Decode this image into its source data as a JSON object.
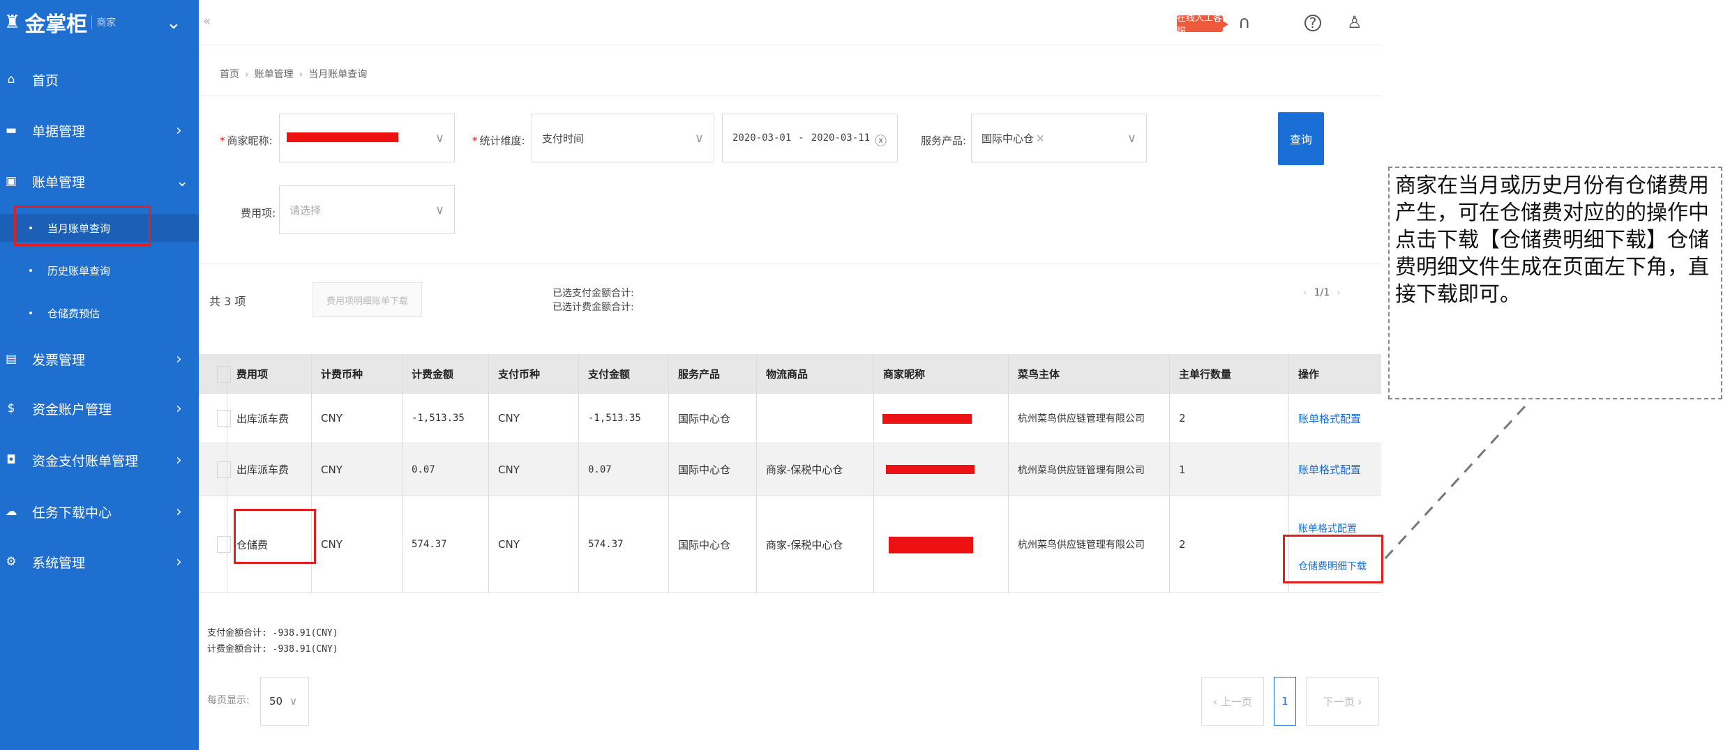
{
  "sidebar": {
    "logo_text": "金掌柜",
    "logo_sub": "商家",
    "collapse_icon": "chevron-down",
    "items": [
      {
        "label": "首页",
        "icon": "home-icon"
      },
      {
        "label": "单据管理",
        "icon": "document-icon"
      },
      {
        "label": "账单管理",
        "icon": "bill-icon"
      },
      {
        "label": "发票管理",
        "icon": "invoice-icon"
      },
      {
        "label": "资金账户管理",
        "icon": "dollar-icon"
      },
      {
        "label": "资金支付账单管理",
        "icon": "payment-icon"
      },
      {
        "label": "任务下载中心",
        "icon": "download-task-icon"
      },
      {
        "label": "系统管理",
        "icon": "settings-icon"
      }
    ],
    "sub_items": [
      {
        "label": "当月账单查询",
        "active": true
      },
      {
        "label": "历史账单查询",
        "active": false
      },
      {
        "label": "仓储费预估",
        "active": false
      }
    ],
    "accent": "#1f6fd1"
  },
  "topbar": {
    "collapse": "«",
    "online_service": "在线人工客服",
    "icons": [
      "headset-icon",
      "help-icon",
      "user-icon"
    ]
  },
  "breadcrumb": [
    "首页",
    "账单管理",
    "当月账单查询"
  ],
  "form": {
    "merchant_label": "商家昵称:",
    "dimension_label": "统计维度:",
    "dimension_value": "支付时间",
    "date_start": "2020-03-01",
    "date_sep": "-",
    "date_end": "2020-03-11",
    "product_label": "服务产品:",
    "product_tag": "国际中心仓",
    "fee_label": "费用项:",
    "fee_placeholder": "请选择",
    "query_button": "查询"
  },
  "toolbar": {
    "count": "共 3 项",
    "download_button": "费用项明细账单下载",
    "sum_paid_label": "已选支付金额合计:",
    "sum_bill_label": "已选计费金额合计:",
    "page_mini": "1/1"
  },
  "table": {
    "columns": [
      "费用项",
      "计费币种",
      "计费金额",
      "支付币种",
      "支付金额",
      "服务产品",
      "物流商品",
      "商家昵称",
      "菜鸟主体",
      "主单行数量",
      "操作"
    ],
    "rows": [
      {
        "fee": "出库派车费",
        "bill_currency": "CNY",
        "bill_amount": "-1,513.35",
        "pay_currency": "CNY",
        "pay_amount": "-1,513.35",
        "product": "国际中心仓",
        "goods": "",
        "entity": "杭州菜鸟供应链管理有限公司",
        "count": "2",
        "action1": "账单格式配置",
        "action2": ""
      },
      {
        "fee": "出库派车费",
        "bill_currency": "CNY",
        "bill_amount": "0.07",
        "pay_currency": "CNY",
        "pay_amount": "0.07",
        "product": "国际中心仓",
        "goods": "商家-保税中心仓",
        "entity": "杭州菜鸟供应链管理有限公司",
        "count": "1",
        "action1": "账单格式配置",
        "action2": ""
      },
      {
        "fee": "仓储费",
        "bill_currency": "CNY",
        "bill_amount": "574.37",
        "pay_currency": "CNY",
        "pay_amount": "574.37",
        "product": "国际中心仓",
        "goods": "商家-保税中心仓",
        "entity": "杭州菜鸟供应链管理有限公司",
        "count": "2",
        "action1": "账单格式配置",
        "action2": "仓储费明细下载"
      }
    ]
  },
  "footer": {
    "sum_paid": "支付金额合计: -938.91(CNY)",
    "sum_bill": "计费金额合计: -938.91(CNY)",
    "page_size_label": "每页显示:",
    "page_size": "50",
    "prev": "‹ 上一页",
    "current_page": "1",
    "next": "下一页 ›"
  },
  "callout": {
    "text": "商家在当月或历史月份有仓储费用产生，可在仓储费对应的的操作中点击下载【仓储费明细下载】仓储费明细文件生成在页面左下角，直接下载即可。"
  },
  "colors": {
    "redact": "#ee1111",
    "highlight": "#e02020",
    "link": "#1a6fd6"
  }
}
